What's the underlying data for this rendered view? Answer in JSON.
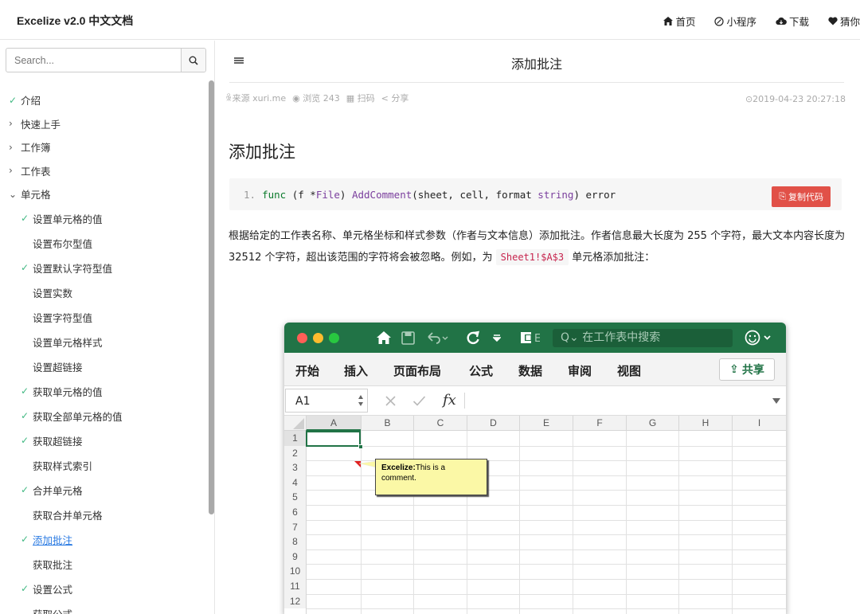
{
  "header": {
    "brand": "Excelize v2.0 中文文档",
    "nav": [
      {
        "icon": "home-icon",
        "label": "首页"
      },
      {
        "icon": "miniprogram-icon",
        "label": "小程序"
      },
      {
        "icon": "cloud-download-icon",
        "label": "下载"
      },
      {
        "icon": "heart-icon",
        "label": "猜你"
      }
    ]
  },
  "sidebar": {
    "search_placeholder": "Search...",
    "items": [
      {
        "label": "介绍",
        "level": 0,
        "mark": "check"
      },
      {
        "label": "快速上手",
        "level": 0,
        "mark": "collapsed"
      },
      {
        "label": "工作簿",
        "level": 0,
        "mark": "collapsed"
      },
      {
        "label": "工作表",
        "level": 0,
        "mark": "collapsed"
      },
      {
        "label": "单元格",
        "level": 0,
        "mark": "expanded"
      },
      {
        "label": "设置单元格的值",
        "level": 1,
        "mark": "check"
      },
      {
        "label": "设置布尔型值",
        "level": 1,
        "mark": ""
      },
      {
        "label": "设置默认字符型值",
        "level": 1,
        "mark": "check"
      },
      {
        "label": "设置实数",
        "level": 1,
        "mark": ""
      },
      {
        "label": "设置字符型值",
        "level": 1,
        "mark": ""
      },
      {
        "label": "设置单元格样式",
        "level": 1,
        "mark": ""
      },
      {
        "label": "设置超链接",
        "level": 1,
        "mark": ""
      },
      {
        "label": "获取单元格的值",
        "level": 1,
        "mark": "check"
      },
      {
        "label": "获取全部单元格的值",
        "level": 1,
        "mark": "check"
      },
      {
        "label": "获取超链接",
        "level": 1,
        "mark": "check"
      },
      {
        "label": "获取样式索引",
        "level": 1,
        "mark": ""
      },
      {
        "label": "合并单元格",
        "level": 1,
        "mark": "check"
      },
      {
        "label": "获取合并单元格",
        "level": 1,
        "mark": ""
      },
      {
        "label": "添加批注",
        "level": 1,
        "mark": "check",
        "active": true
      },
      {
        "label": "获取批注",
        "level": 1,
        "mark": ""
      },
      {
        "label": "设置公式",
        "level": 1,
        "mark": "check"
      },
      {
        "label": "获取公式",
        "level": 1,
        "mark": ""
      }
    ]
  },
  "page": {
    "title": "添加批注",
    "meta_source": "来源 xuri.me",
    "meta_views": "浏览 243",
    "meta_scan": "扫码",
    "meta_share": "分享",
    "date": "2019-04-23 20:27:18",
    "heading": "添加批注",
    "code": {
      "line_no": "1.",
      "tokens": [
        "func",
        "(f *",
        "File",
        ")",
        "AddComment",
        "(sheet, cell, format",
        "string",
        ") error"
      ]
    },
    "copy_label": "复制代码",
    "para_part1": "根据给定的工作表名称、单元格坐标和样式参数（作者与文本信息）添加批注。作者信息最大长度为 255 个字符，最大文本内容长度为 32512 个字符，超出该范围的字符将会被忽略。例如，为",
    "para_code": "Sheet1!$A$3",
    "para_part2": "单元格添加批注："
  },
  "excel": {
    "search_placeholder": "在工作表中搜索",
    "tabs": [
      "开始",
      "插入",
      "页面布局",
      "公式",
      "数据",
      "审阅",
      "视图"
    ],
    "share_label": "共享",
    "name_box": "A1",
    "fx_label": "fx",
    "columns": [
      "A",
      "B",
      "C",
      "D",
      "E",
      "F",
      "G",
      "H",
      "I"
    ],
    "rows": [
      "1",
      "2",
      "3",
      "4",
      "5",
      "6",
      "7",
      "8",
      "9",
      "10",
      "11",
      "12"
    ],
    "comment_author": "Excelize:",
    "comment_text": "This is a comment.",
    "colors": {
      "title_bar": "#217346",
      "dot_red": "#ff5f57",
      "dot_yellow": "#febc2e",
      "dot_green": "#28c840"
    }
  }
}
